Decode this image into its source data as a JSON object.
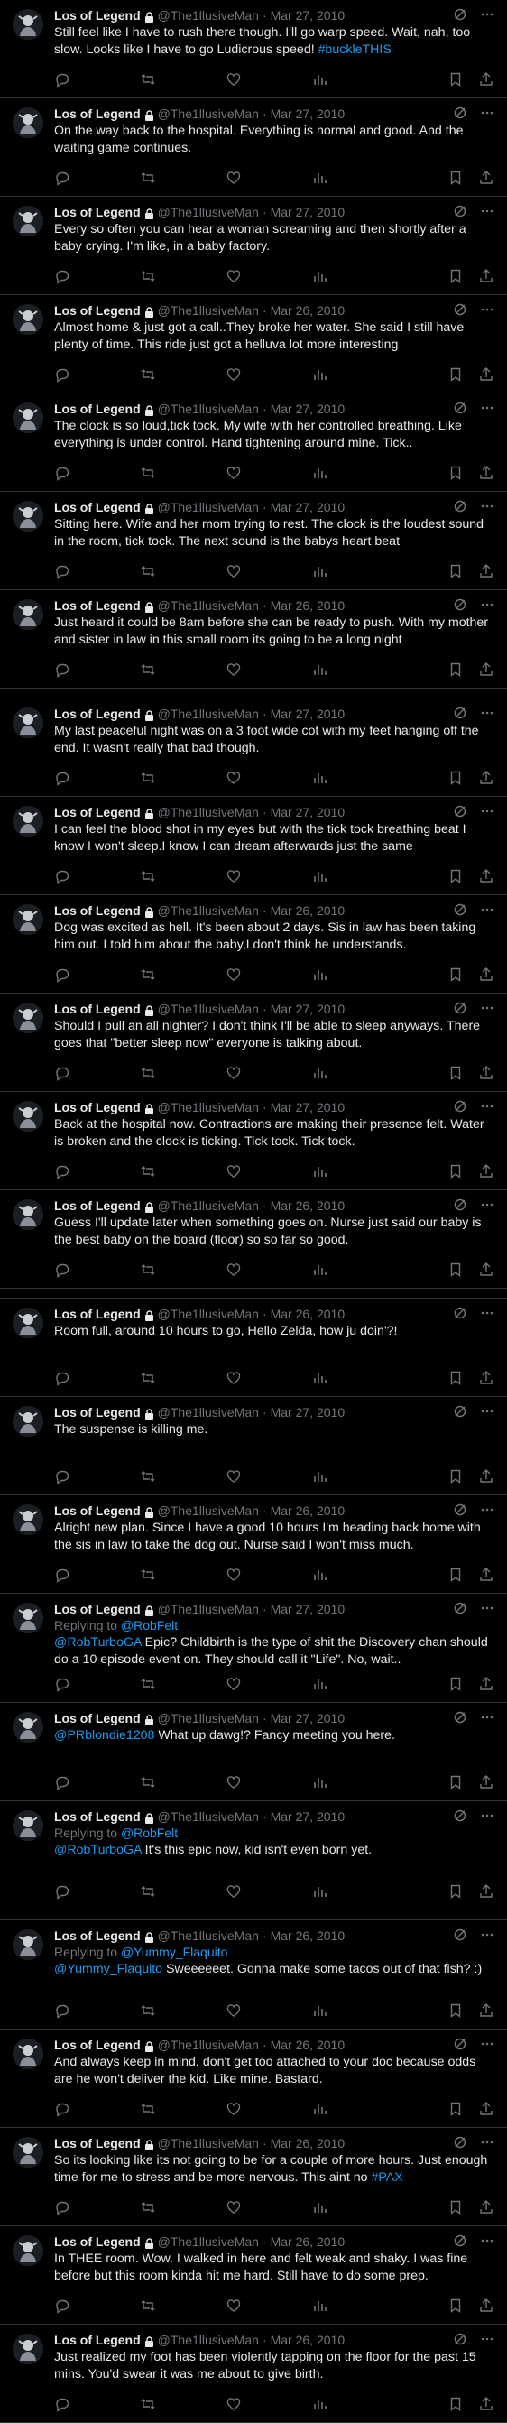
{
  "author": {
    "name": "Los of Legend",
    "handle": "@The1llusiveMan",
    "separator": "·"
  },
  "icons": {
    "lock": "lock-icon",
    "grok": "grok-icon",
    "more": "more-icon",
    "reply": "reply-icon",
    "retweet": "retweet-icon",
    "like": "like-icon",
    "views": "views-icon",
    "bookmark": "bookmark-icon",
    "share": "share-icon"
  },
  "colors": {
    "background": "#000000",
    "link": "#1d9bf0",
    "muted": "#71767b",
    "divider": "#2f3336"
  },
  "tweets": [
    {
      "date": "Mar 27, 2010",
      "text": "Still feel like I have to rush there though. I'll go warp speed. Wait, nah, too slow. Looks like I have to go Ludicrous speed! ",
      "link": "#buckleTHIS"
    },
    {
      "date": "Mar 27, 2010",
      "text": "On the way back to the hospital. Everything is normal and good. And the waiting game continues."
    },
    {
      "date": "Mar 27, 2010",
      "text": "Every so often you can hear a woman screaming and then shortly after a baby crying. I'm like, in a baby factory."
    },
    {
      "date": "Mar 26, 2010",
      "text": "Almost home & just got a call..They broke her water. She said I still have plenty of time. This ride just got a helluva lot more interesting"
    },
    {
      "date": "Mar 27, 2010",
      "text": "The clock is so loud,tick tock. My wife with her controlled breathing. Like everything is under control. Hand tightening around mine. Tick.."
    },
    {
      "date": "Mar 27, 2010",
      "text": "Sitting here. Wife and her mom trying to rest. The clock is the loudest sound in the room, tick tock. The next sound is the babys heart beat"
    },
    {
      "date": "Mar 26, 2010",
      "text": "Just heard it could be 8am before she can be ready to push. With my mother and sister in law in this small room its going to be a long night"
    },
    {
      "date": "Mar 27, 2010",
      "text": "My last peaceful night was on a 3 foot wide cot with my feet hanging off the end. It wasn't really that bad though."
    },
    {
      "date": "Mar 27, 2010",
      "text": "I can feel the blood shot in my eyes but with the tick tock breathing beat I know I won't sleep.I know I can dream afterwards just the same"
    },
    {
      "date": "Mar 26, 2010",
      "text": "Dog was excited as hell. It's been about 2 days. Sis in law has been taking him out. I told him about the baby,I don't think he understands."
    },
    {
      "date": "Mar 27, 2010",
      "text": "Should I pull an all nighter? I don't think I'll be able to sleep anyways. There goes that \"better sleep now\" everyone is talking about."
    },
    {
      "date": "Mar 27, 2010",
      "text": "Back at the hospital now. Contractions are making their presence felt. Water is broken and the clock is ticking. Tick tock. Tick tock."
    },
    {
      "date": "Mar 26, 2010",
      "text": "Guess I'll update later when something goes on. Nurse just said our baby is the best baby on the board (floor) so so far so good."
    },
    {
      "date": "Mar 26, 2010",
      "text": "Room full, around 10 hours to go, Hello Zelda, how ju doin'?!"
    },
    {
      "date": "Mar 27, 2010",
      "text": "The suspense is killing me."
    },
    {
      "date": "Mar 26, 2010",
      "text": "Alright new plan. Since I have a good 10 hours I'm heading back home with the sis in law to take the dog out. Nurse said I won't miss much."
    },
    {
      "date": "Mar 27, 2010",
      "replying": "Replying to ",
      "reply_to": "@RobFelt",
      "mention": "@RobTurboGA",
      "text": " Epic? Childbirth is the type of shit the Discovery chan should do a 10 episode event on. They should call it \"Life\". No, wait.."
    },
    {
      "date": "Mar 27, 2010",
      "mention": "@PRblondie1208",
      "text": " What up dawg!? Fancy meeting you here."
    },
    {
      "date": "Mar 27, 2010",
      "replying": "Replying to ",
      "reply_to": "@RobFelt",
      "mention": "@RobTurboGA",
      "text": " It's this epic now, kid isn't even born yet."
    },
    {
      "date": "Mar 26, 2010",
      "replying": "Replying to ",
      "reply_to": "@Yummy_Flaquito",
      "mention": "@Yummy_Flaquito",
      "text": " Sweeeeeet. Gonna make some tacos out of that fish? :)"
    },
    {
      "date": "Mar 26, 2010",
      "text": "And always keep in mind, don't get too attached to your doc because odds are he won't deliver the kid. Like mine. Bastard."
    },
    {
      "date": "Mar 26, 2010",
      "text": "So its looking like its not going to be for a couple of more hours. Just enough time for me to stress and be more nervous. This aint no ",
      "link": "#PAX"
    },
    {
      "date": "Mar 26, 2010",
      "text": "In THEE room. Wow. I walked in here and felt weak and shaky. I was fine before but this room kinda hit me hard. Still have to do some prep."
    },
    {
      "date": "Mar 26, 2010",
      "text": "Just realized my foot has been violently tapping on the floor for the past 15 mins. You'd swear it was me about to give birth."
    }
  ]
}
